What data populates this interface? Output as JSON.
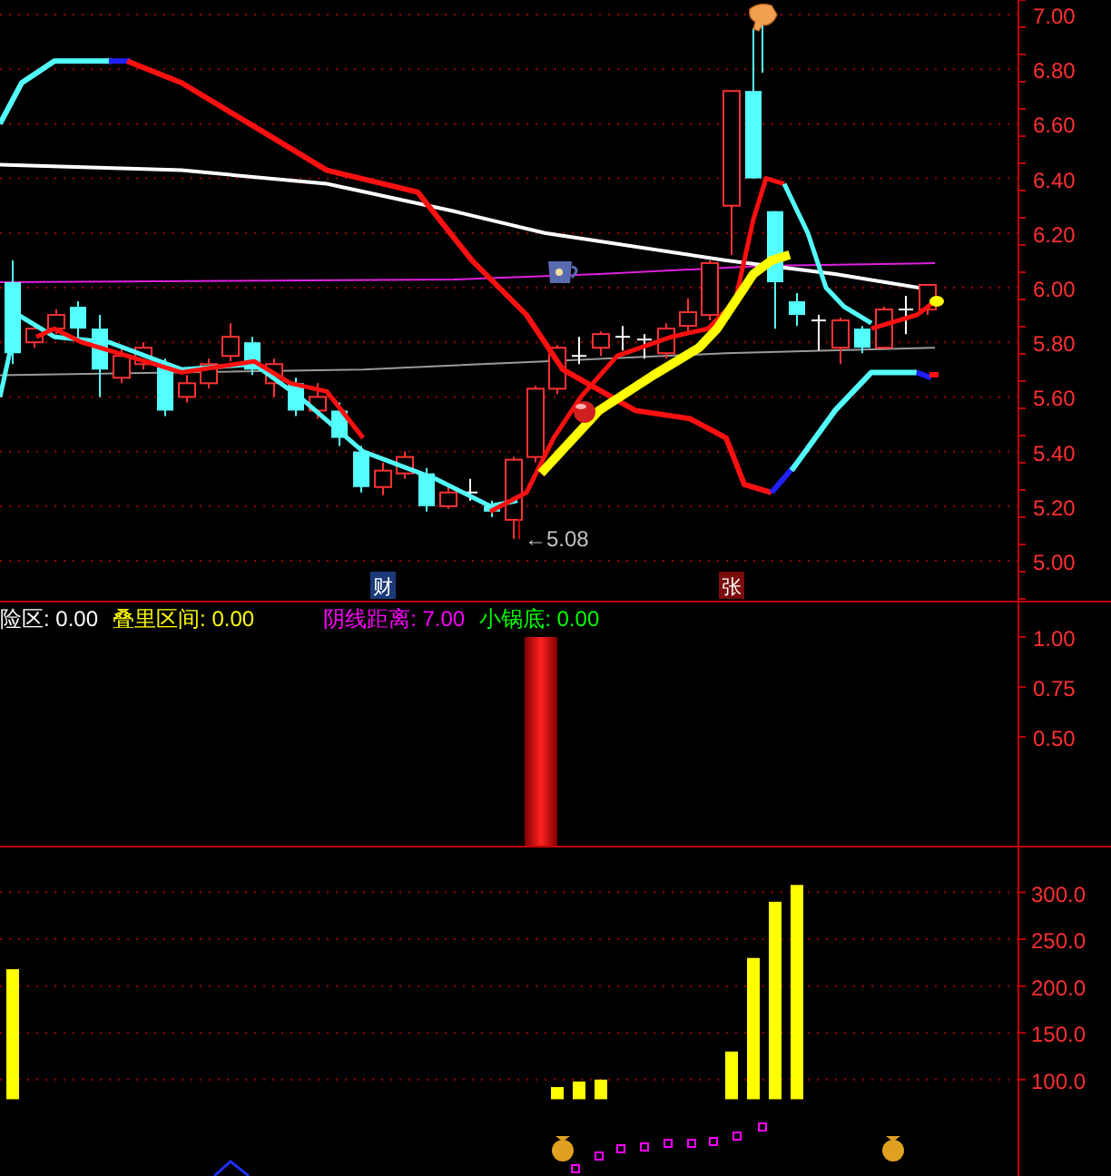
{
  "price_panel": {
    "axis_labels": [
      "7.00",
      "6.80",
      "6.60",
      "6.40",
      "6.20",
      "6.00",
      "5.80",
      "5.60",
      "5.40",
      "5.20",
      "5.00"
    ],
    "low_marker": "←5.08",
    "event_tags": [
      {
        "text": "财",
        "color": "#1c3a78"
      },
      {
        "text": "张",
        "color": "#7a0c0c"
      }
    ]
  },
  "indicator_panel": {
    "readouts": [
      {
        "label": "险区: 0.00",
        "color": "#ffffff"
      },
      {
        "label": "叠里区间: 0.00",
        "color": "#ffff00"
      },
      {
        "label": "阴线距离: 7.00",
        "color": "#ff00ff"
      },
      {
        "label": "小锅底: 0.00",
        "color": "#00ff00"
      }
    ],
    "axis_labels": [
      "1.00",
      "0.75",
      "0.50"
    ]
  },
  "volume_panel": {
    "axis_labels": [
      "300.0",
      "250.0",
      "200.0",
      "150.0",
      "100.0"
    ]
  }
}
